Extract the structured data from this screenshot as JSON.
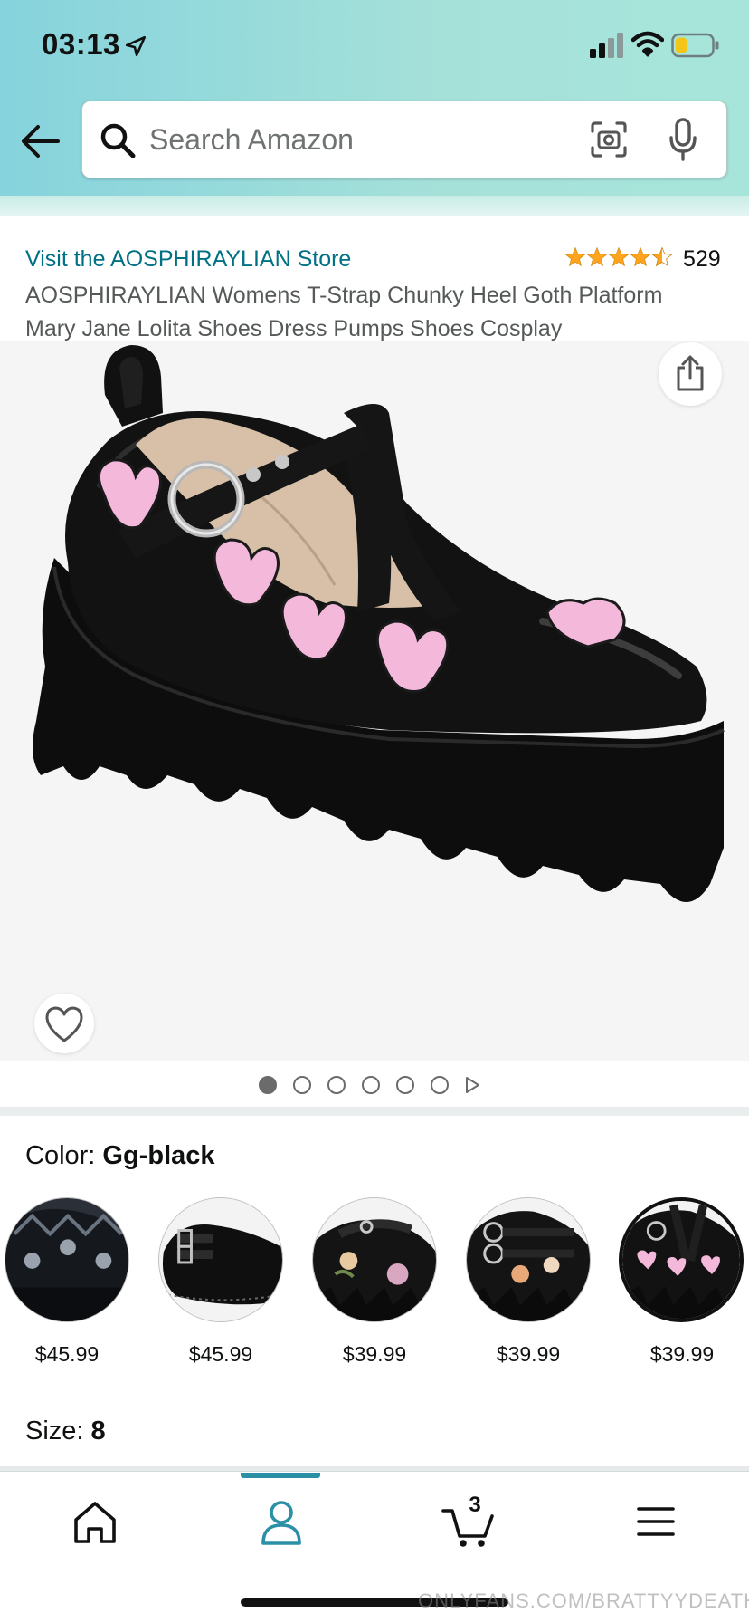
{
  "status_bar": {
    "time": "03:13",
    "battery_level": 0.25,
    "battery_color": "#f5c518"
  },
  "search": {
    "placeholder": "Search Amazon"
  },
  "product": {
    "store_link": "Visit the AOSPHIRAYLIAN Store",
    "rating_stars": 4.5,
    "rating_count": "529",
    "title": "AOSPHIRAYLIAN Womens T-Strap Chunky Heel Goth Platform Mary Jane Lolita Shoes Dress Pumps Shoes Cosplay"
  },
  "gallery": {
    "image_count": 6,
    "active_index": 0
  },
  "color": {
    "label": "Color:",
    "selected": "Gg-black",
    "options": [
      {
        "price": "$45.99"
      },
      {
        "price": "$45.99"
      },
      {
        "price": "$39.99"
      },
      {
        "price": "$39.99"
      },
      {
        "price": "$39.99"
      }
    ],
    "selected_index": 4
  },
  "size": {
    "label": "Size:",
    "selected": "8"
  },
  "bottom_nav": {
    "items": [
      "home-icon",
      "account-icon",
      "cart-icon",
      "menu-icon"
    ],
    "active": "account-icon",
    "cart_count": "3",
    "accent_color": "#2b8fa6"
  },
  "watermark": "ONLYFANS.COM/BRATTYYDEATH",
  "colors": {
    "link": "#007185",
    "star": "#ffa41c",
    "header_gradient": [
      "#86d3dd",
      "#a7e5da"
    ]
  }
}
